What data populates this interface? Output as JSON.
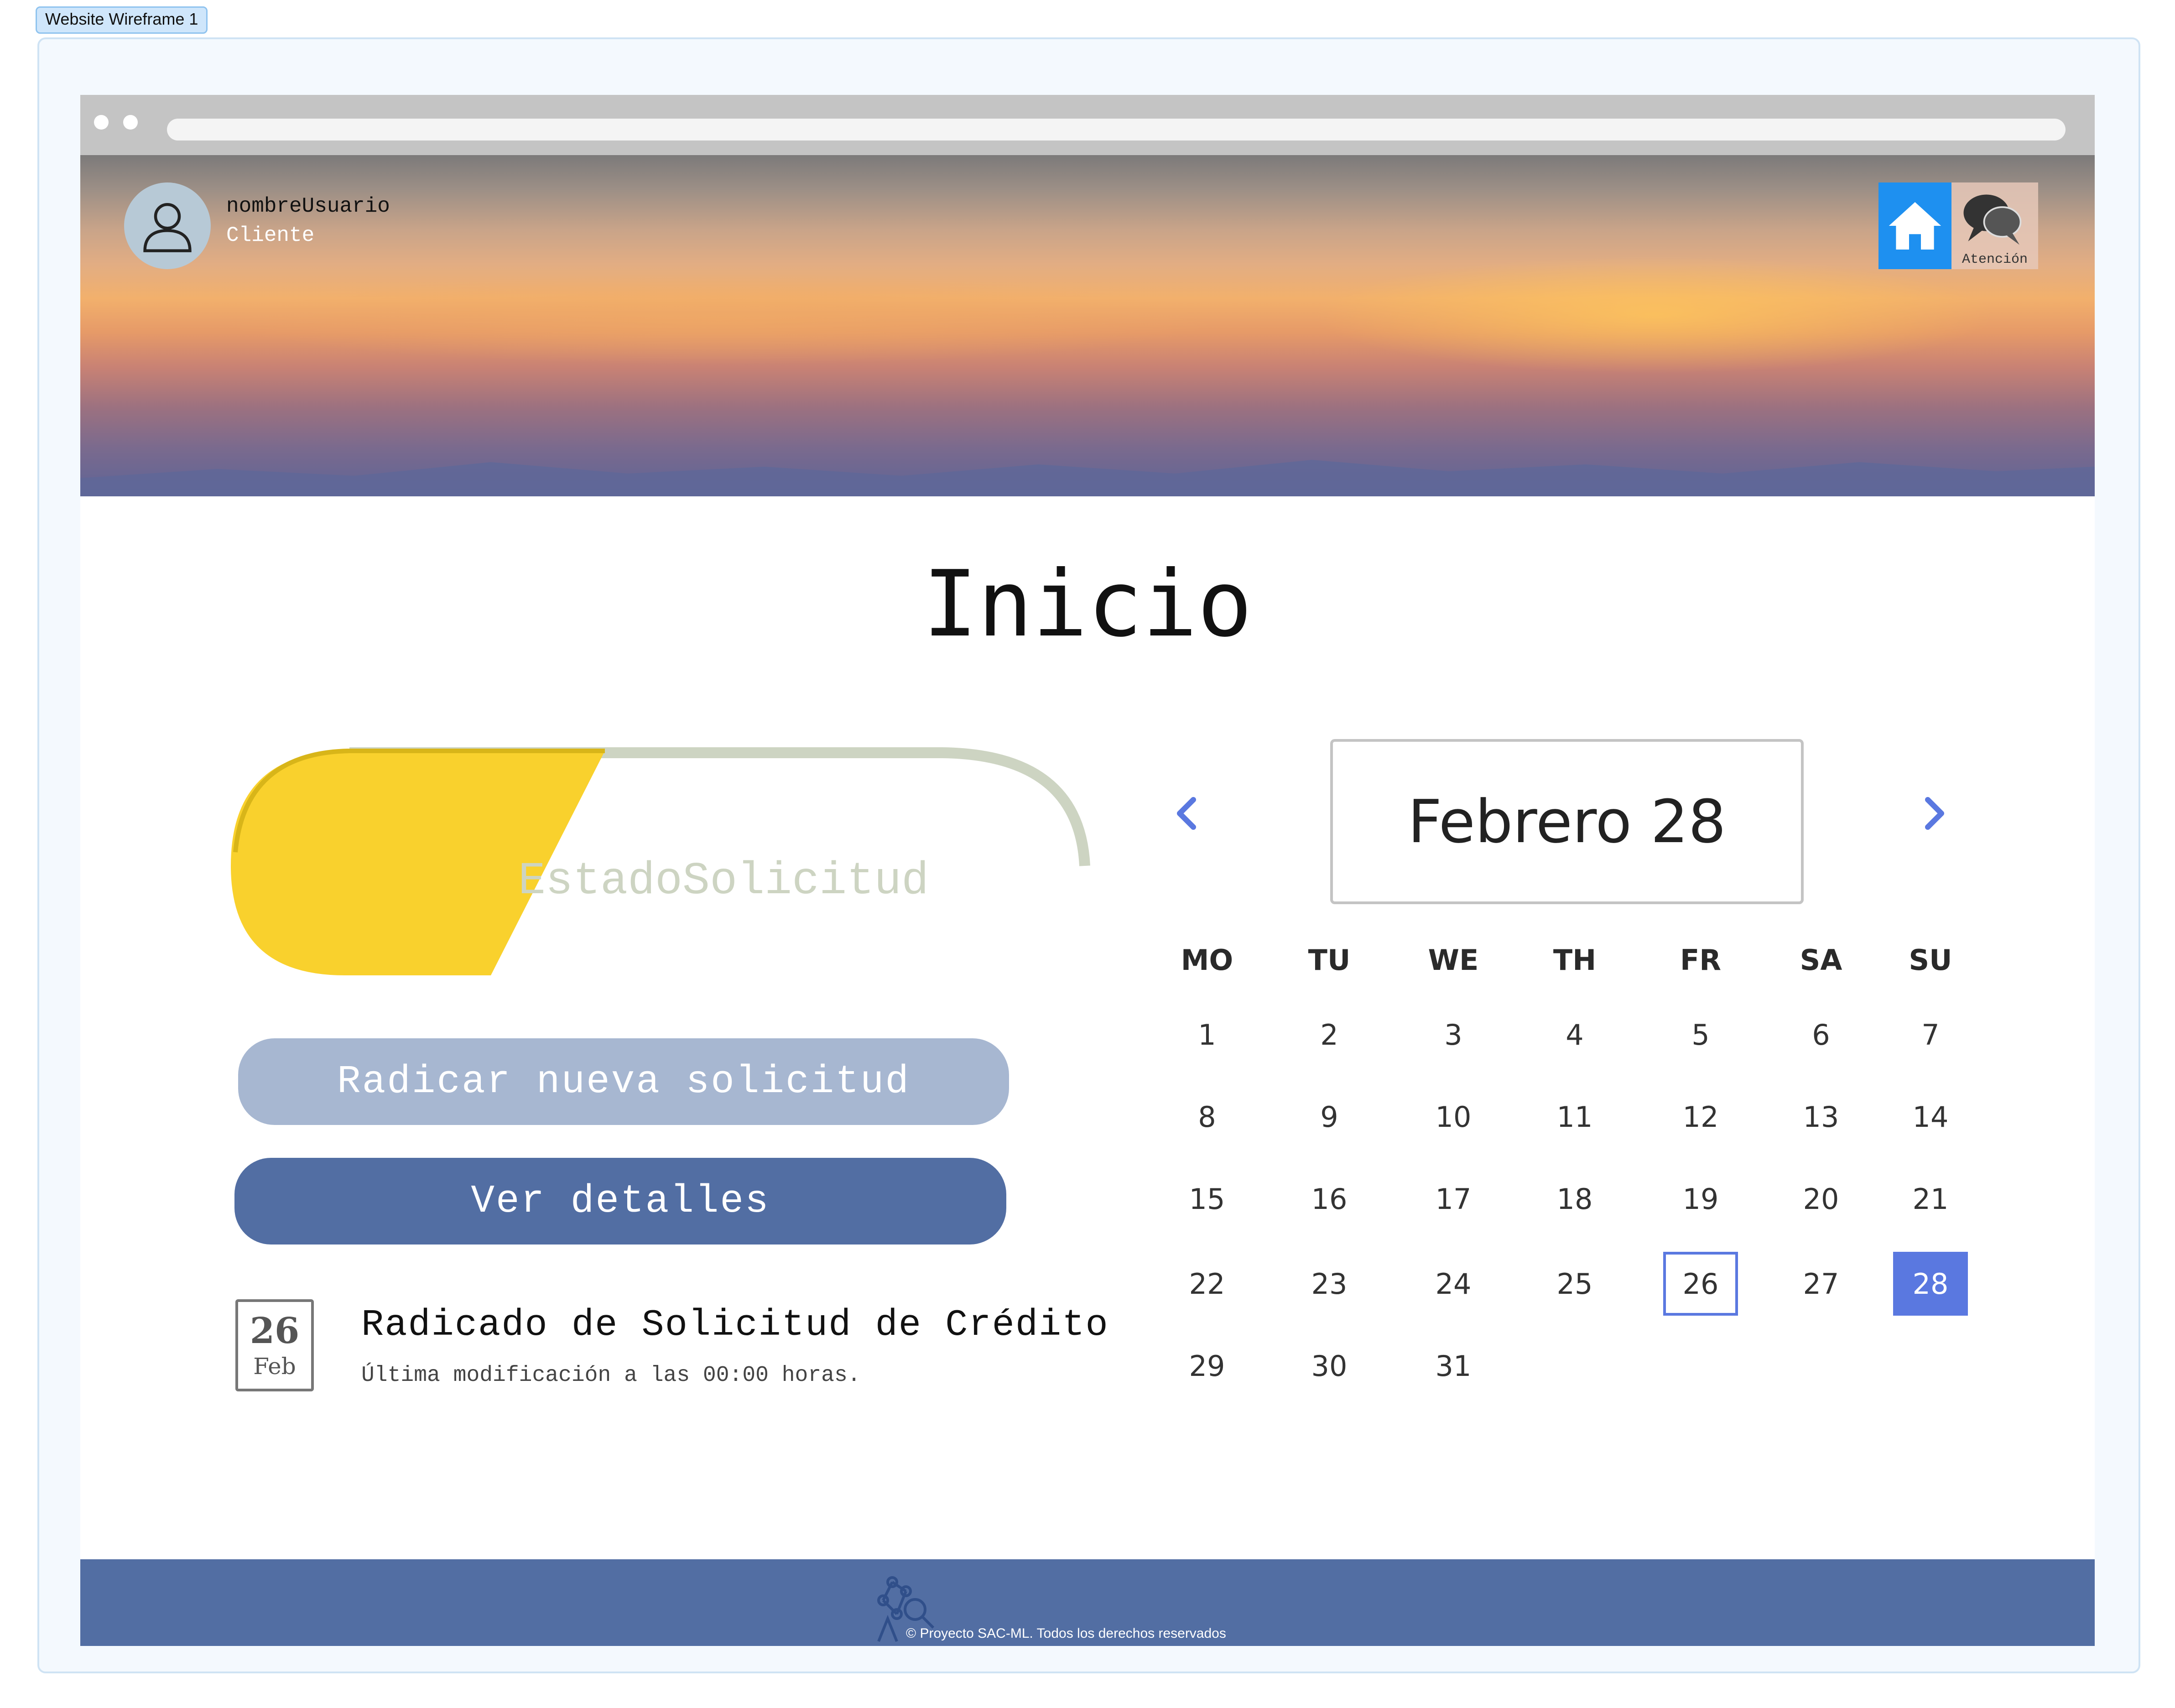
{
  "frame": {
    "label": "Website Wireframe 1"
  },
  "header": {
    "user": {
      "name": "nombreUsuario",
      "role": "Cliente"
    },
    "nav": {
      "home_icon": "home-icon",
      "atencion_label": "Atención",
      "atencion_icon": "chat-bubbles-icon"
    }
  },
  "page": {
    "title": "Inicio"
  },
  "status": {
    "label": "EstadoSolicitud",
    "progress": 0.3,
    "fill_color": "#f9d12d",
    "track_color": "#cdd4c2"
  },
  "actions": {
    "radicar_label": "Radicar nueva solicitud",
    "detalles_label": "Ver detalles"
  },
  "activity": {
    "day": "26",
    "month": "Feb",
    "title": "Radicado de Solicitud de Crédito",
    "subtitle": "Última modificación a las 00:00 horas."
  },
  "calendar": {
    "title": "Febrero 28",
    "weekdays": [
      "MO",
      "TU",
      "WE",
      "TH",
      "FR",
      "SA",
      "SU"
    ],
    "weeks": [
      [
        "1",
        "2",
        "3",
        "4",
        "5",
        "6",
        "7"
      ],
      [
        "8",
        "9",
        "10",
        "11",
        "12",
        "13",
        "14"
      ],
      [
        "15",
        "16",
        "17",
        "18",
        "19",
        "20",
        "21"
      ],
      [
        "22",
        "23",
        "24",
        "25",
        "26",
        "27",
        "28"
      ],
      [
        "29",
        "30",
        "31",
        "",
        "",
        "",
        ""
      ]
    ],
    "today": "26",
    "selected": "28",
    "accent_color": "#5a78e0"
  },
  "footer": {
    "text": "© Proyecto SAC-ML. Todos los derechos reservados"
  }
}
